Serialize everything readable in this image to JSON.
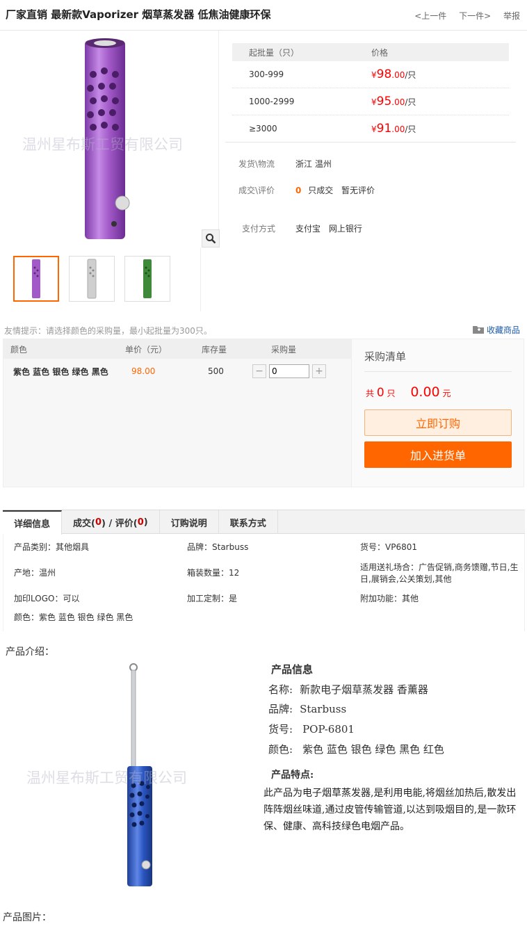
{
  "header": {
    "title": "厂家直销 最新款Vaporizer 烟草蒸发器 低焦油健康环保",
    "prev": "<上一件",
    "next": "下一件>",
    "report": "举报"
  },
  "gallery": {
    "watermark": "温州星布斯工贸有限公司",
    "thumbs": [
      "purple",
      "silver",
      "green"
    ],
    "colors": {
      "purple": "#a25ac8",
      "silver": "#d0d0d0",
      "green": "#3e8a3a",
      "blue": "#2a55c0"
    }
  },
  "price_table": {
    "col_qty": "起批量（只）",
    "col_price": "价格",
    "currency": "¥",
    "unit": "/只",
    "rows": [
      {
        "qty": "300-999",
        "int": "98",
        "dec": ".00"
      },
      {
        "qty": "1000-2999",
        "int": "95",
        "dec": ".00"
      },
      {
        "qty": "≥3000",
        "int": "91",
        "dec": ".00"
      }
    ]
  },
  "info": {
    "ship_label": "发货\\物流",
    "ship_value": "浙江 温州",
    "deal_label": "成交\\评价",
    "deal_count": "0",
    "deal_text": "只成交",
    "review_text": "暂无评价",
    "pay_label": "支付方式",
    "pay_1": "支付宝",
    "pay_2": "网上银行"
  },
  "tip": "友情提示：请选择颜色的采购量，最小起批量为300只。",
  "favorite": "收藏商品",
  "sku": {
    "headers": {
      "color": "颜色",
      "price": "单价（元）",
      "stock": "库存量",
      "qty": "采购量"
    },
    "row": {
      "color": "紫色 蓝色 银色 绿色 黑色",
      "price": "98.00",
      "stock": "500",
      "qty": "0"
    }
  },
  "cart": {
    "title": "采购清单",
    "total_prefix": "共",
    "total_count": "0",
    "total_unit": "只",
    "total_amount": "0.00",
    "amount_unit": "元",
    "order_button": "立即订购",
    "cart_button": "加入进货单"
  },
  "tabs": {
    "detail": "详细信息",
    "deal_prefix": "成交(",
    "deal_count": "0",
    "deal_mid": ") / 评价(",
    "review_count": "0",
    "deal_suffix": ")",
    "order_notes": "订购说明",
    "contact": "联系方式"
  },
  "attributes": {
    "category": "产品类别：其他烟具",
    "brand": "品牌：Starbuss",
    "sku_no": "货号：VP6801",
    "origin": "产地：温州",
    "box_qty": "箱装数量：12",
    "occasion": "适用送礼场合：广告促销,商务馈赠,节日,生日,展销会,公关策划,其他",
    "logo": "加印LOGO：可以",
    "custom": "加工定制：是",
    "extra": "附加功能：其他",
    "colors": "颜色：紫色 蓝色 银色 绿色 黑色"
  },
  "intro": {
    "heading": "产品介绍：",
    "info_title": "产品信息",
    "name_label": "名称:",
    "name": "新款电子烟草蒸发器 香薰器",
    "brand_label": "品牌:",
    "brand": "Starbuss",
    "sku_label": "货号:",
    "sku": "POP-6801",
    "color_label": "颜色:",
    "colors": "紫色 蓝色 银色 绿色 黑色 红色",
    "features_title": "产品特点:",
    "features": "此产品为电子烟草蒸发器,是利用电能,将烟丝加热后,散发出阵阵烟丝味道,通过皮管传输管道,以达到吸烟目的,是一款环保、健康、高科技绿色电烟产品。",
    "watermark": "温州星布斯工贸有限公司",
    "pictures_heading": "产品图片："
  }
}
